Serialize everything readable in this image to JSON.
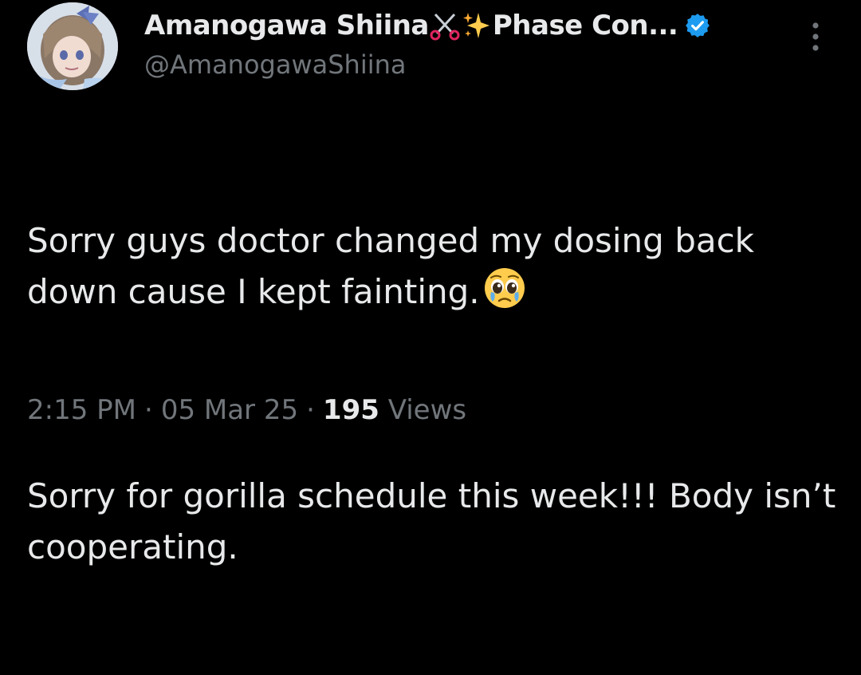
{
  "tweet": {
    "author": {
      "display_name": "Amanogawa Shiina",
      "display_name_suffix": "Phase Con...",
      "name_emojis": [
        "scissors-icon",
        "sparkles-icon"
      ],
      "handle": "@AmanogawaShiina",
      "verified": true
    },
    "paragraph_1": "Sorry guys doctor changed my dosing back down cause I kept fainting.",
    "paragraph_1_emoji": "pleading-face-with-tears-icon",
    "paragraph_2": "Sorry for gorilla schedule this week!!! Body isn’t cooperating.",
    "meta": {
      "time": "2:15 PM",
      "date": "05 Mar 25",
      "views_count": "195",
      "views_label": "Views",
      "separator": "·"
    }
  },
  "colors": {
    "background": "#000000",
    "text_primary": "#e7e9ea",
    "text_secondary": "#71767b",
    "verified_blue": "#1d9bf0"
  }
}
